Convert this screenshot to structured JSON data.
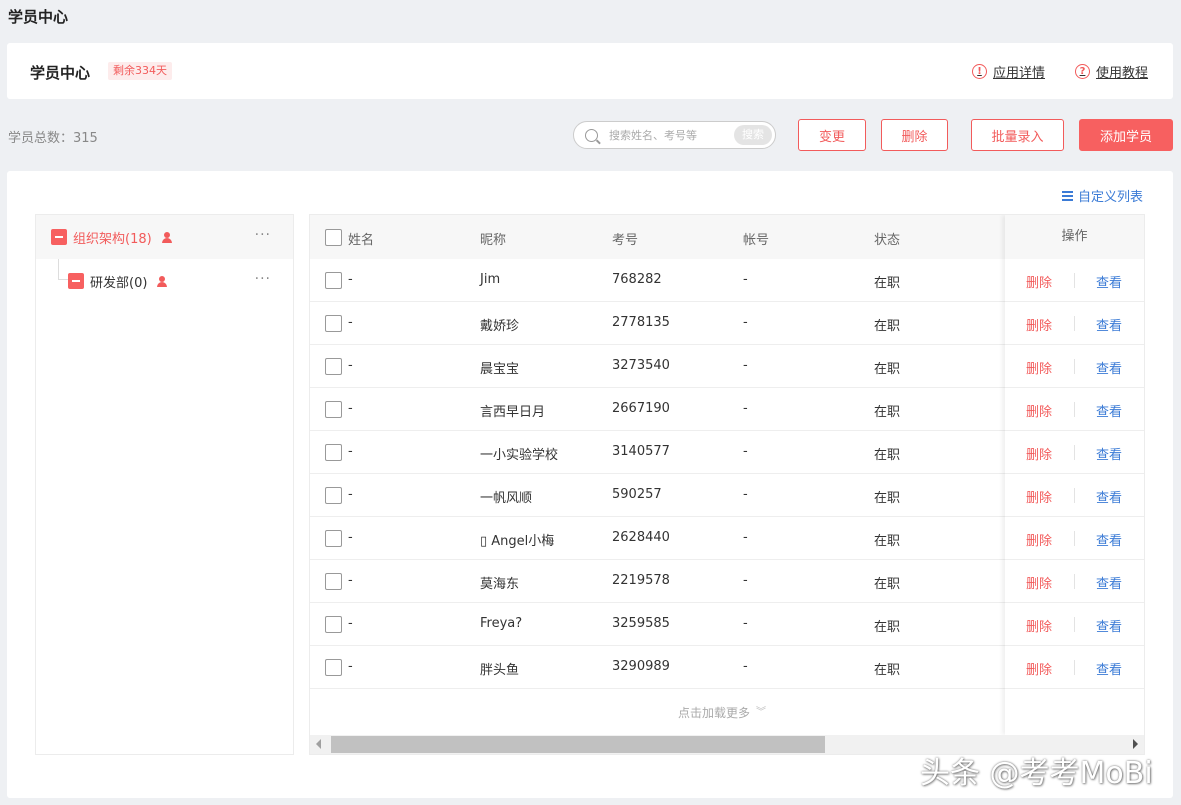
{
  "page": {
    "title": "学员中心"
  },
  "header": {
    "title": "学员中心",
    "remaining_badge": "剩余334天",
    "links": [
      {
        "label": "应用详情",
        "icon": "exclamation-circle-icon",
        "icon_glyph": "!"
      },
      {
        "label": "使用教程",
        "icon": "question-circle-icon",
        "icon_glyph": "?"
      }
    ]
  },
  "toolbar": {
    "total_label": "学员总数：315",
    "search": {
      "placeholder": "搜索姓名、考号等",
      "value": "",
      "button_label": "搜索"
    },
    "buttons": {
      "change": "变更",
      "delete": "删除",
      "batch_import": "批量录入",
      "add_student": "添加学员"
    }
  },
  "custom_list_label": "自定义列表",
  "tree": {
    "root": {
      "label": "组织架构(18)",
      "more": "···"
    },
    "children": [
      {
        "label": "研发部(0)",
        "more": "···"
      }
    ]
  },
  "table": {
    "columns": [
      "姓名",
      "昵称",
      "考号",
      "帐号",
      "状态",
      "操作"
    ],
    "rows": [
      {
        "name": "-",
        "nickname": "Jim",
        "exam_no": "768282",
        "account": "-",
        "status": "在职"
      },
      {
        "name": "-",
        "nickname": "戴娇珍",
        "exam_no": "2778135",
        "account": "-",
        "status": "在职"
      },
      {
        "name": "-",
        "nickname": "晨宝宝",
        "exam_no": "3273540",
        "account": "-",
        "status": "在职"
      },
      {
        "name": "-",
        "nickname": "言西早日月",
        "exam_no": "2667190",
        "account": "-",
        "status": "在职"
      },
      {
        "name": "-",
        "nickname": "一小实验学校",
        "exam_no": "3140577",
        "account": "-",
        "status": "在职"
      },
      {
        "name": "-",
        "nickname": "一帆风顺",
        "exam_no": "590257",
        "account": "-",
        "status": "在职"
      },
      {
        "name": "-",
        "nickname": "▯ Angel小梅",
        "exam_no": "2628440",
        "account": "-",
        "status": "在职"
      },
      {
        "name": "-",
        "nickname": "莫海东",
        "exam_no": "2219578",
        "account": "-",
        "status": "在职"
      },
      {
        "name": "-",
        "nickname": "Freya?",
        "exam_no": "3259585",
        "account": "-",
        "status": "在职"
      },
      {
        "name": "-",
        "nickname": "胖头鱼",
        "exam_no": "3290989",
        "account": "-",
        "status": "在职"
      }
    ],
    "row_actions": {
      "delete": "删除",
      "view": "查看"
    },
    "load_more": "点击加载更多"
  },
  "watermark": "头条 @考考MoBi",
  "colors": {
    "accent": "#f76060",
    "link": "#3b7bd6",
    "background": "#eef0f3"
  }
}
